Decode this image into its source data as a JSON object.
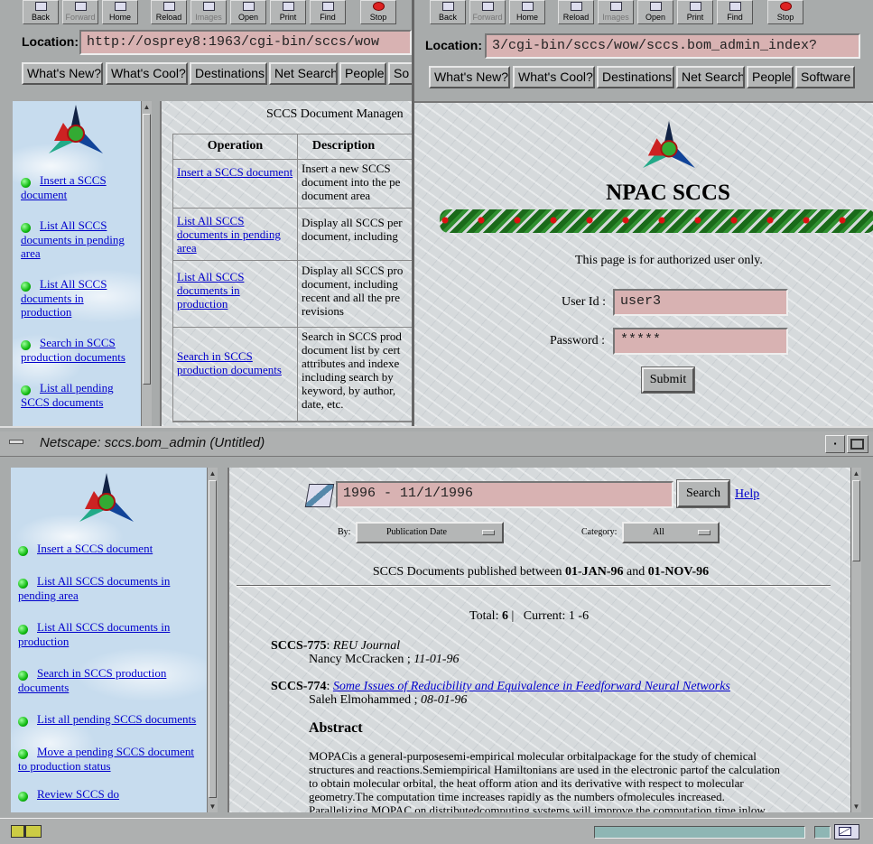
{
  "toolbar": {
    "back": "Back",
    "forward": "Forward",
    "home": "Home",
    "reload": "Reload",
    "images": "Images",
    "open": "Open",
    "print": "Print",
    "find": "Find",
    "stop": "Stop"
  },
  "location_label": "Location:",
  "left_window": {
    "location": "http://osprey8:1963/cgi-bin/sccs/wow",
    "dir_buttons": [
      "What's New?",
      "What's Cool?",
      "Destinations",
      "Net Search",
      "People",
      "So"
    ],
    "nav": [
      "Insert a SCCS document",
      "List All SCCS documents in pending area",
      "List All SCCS documents in production",
      "Search in SCCS production documents",
      "List all pending SCCS documents"
    ],
    "content_title": "SCCS Document Managen",
    "table_headers": [
      "Operation",
      "Description"
    ],
    "rows": [
      {
        "op": "Insert a SCCS document",
        "desc": "Insert a new SCCS document into the pe document area"
      },
      {
        "op": "List All SCCS documents in pending area",
        "desc": "Display all SCCS per document, including"
      },
      {
        "op": "List All SCCS documents in production",
        "desc": "Display all SCCS pro document, including recent and all the pre revisions"
      },
      {
        "op": "Search in SCCS production documents",
        "desc": "Search in SCCS prod document list by cert attributes and indexe including search by keyword, by author, date, etc."
      }
    ]
  },
  "right_window": {
    "location": "3/cgi-bin/sccs/wow/sccs.bom_admin_index?",
    "dir_buttons": [
      "What's New?",
      "What's Cool?",
      "Destinations",
      "Net Search",
      "People",
      "Software"
    ],
    "title": "NPAC SCCS",
    "notice": "This page is for authorized user only.",
    "userid_label": "User Id :",
    "userid_value": "user3",
    "password_label": "Password :",
    "password_value": "*****",
    "submit_label": "Submit"
  },
  "bottom_window": {
    "title": "Netscape: sccs.bom_admin (Untitled)",
    "nav": [
      "Insert a SCCS document",
      "List All SCCS documents in pending area",
      "List All SCCS documents in production",
      "Search in SCCS production documents",
      "List all pending SCCS documents",
      "Move a pending SCCS document to production status",
      "Review SCCS do"
    ],
    "search_value": "1996 - 11/1/1996",
    "search_button": "Search",
    "help_link": "Help",
    "by_label": "By:",
    "by_value": "Publication Date",
    "category_label": "Category:",
    "category_value": "All",
    "summary_pre": "SCCS Documents published between ",
    "summary_from": "01-JAN-96",
    "summary_and": " and ",
    "summary_to": "01-NOV-96",
    "total_label": "Total: ",
    "total_value": "6",
    "current_label": "Current: 1 -6",
    "docs": [
      {
        "id": "SCCS-775",
        "sep": ": ",
        "title": "REU Journal",
        "author": "Nancy McCracken",
        "date": "11-01-96"
      },
      {
        "id": "SCCS-774",
        "sep": ": ",
        "title": "Some Issues of Reducibility and Equivalence in Feedforward Neural Networks",
        "author": "Saleh Elmohammed",
        "date": "08-01-96"
      }
    ],
    "abstract_heading": "Abstract",
    "abstract_lines": [
      "MOPACis a general-purposesemi-empirical molecular orbitalpackage for the study of chemical",
      "structures and reactions.Semiempirical Hamiltonians are used in the electronic partof the calculation",
      "to obtain molecular orbital, the heat ofform ation and its derivative with respect to molecular",
      "geometry.The computation time increases rapidly as the numbers ofmolecules increased.",
      "Parallelizing MOPAC on distributedcomputing systems will improve the computation time inlow"
    ]
  }
}
